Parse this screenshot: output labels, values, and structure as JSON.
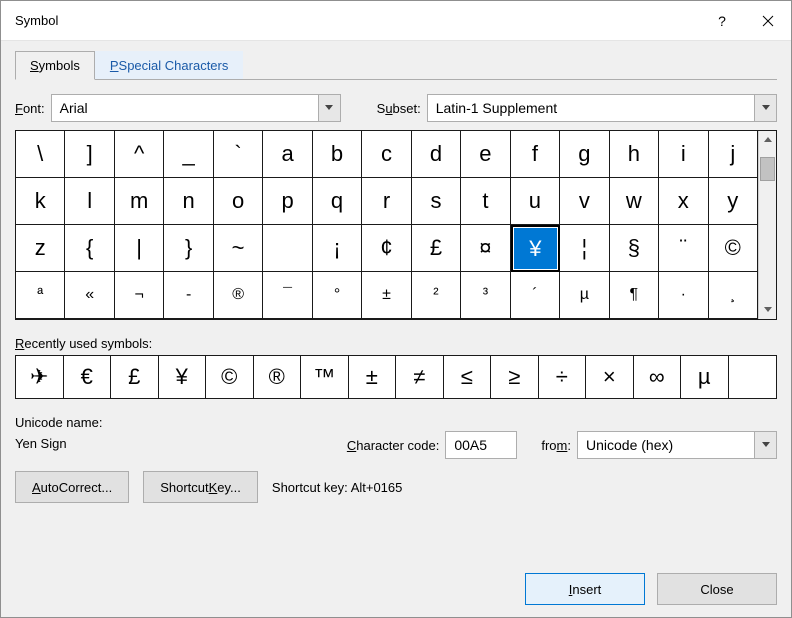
{
  "title": "Symbol",
  "tabs": {
    "symbols": "Symbols",
    "special": "Special Characters"
  },
  "font": {
    "label": "Font:",
    "value": "Arial"
  },
  "subset": {
    "label": "Subset:",
    "value": "Latin-1 Supplement"
  },
  "symbol_grid": {
    "rows": [
      [
        "\\",
        "]",
        "^",
        "_",
        "`",
        "a",
        "b",
        "c",
        "d",
        "e",
        "f",
        "g",
        "h",
        "i",
        "j"
      ],
      [
        "k",
        "l",
        "m",
        "n",
        "o",
        "p",
        "q",
        "r",
        "s",
        "t",
        "u",
        "v",
        "w",
        "x",
        "y"
      ],
      [
        "z",
        "{",
        "|",
        "}",
        "~",
        "",
        "¡",
        "¢",
        "£",
        "¤",
        "¥",
        "¦",
        "§",
        "¨",
        "©"
      ],
      [
        "ª",
        "«",
        "¬",
        "-",
        "®",
        "¯",
        "°",
        "±",
        "²",
        "³",
        "´",
        "µ",
        "¶",
        "·",
        "¸"
      ]
    ],
    "selected": {
      "row": 2,
      "col": 10
    }
  },
  "recent": {
    "label": "Recently used symbols:",
    "items": [
      "✈",
      "€",
      "£",
      "¥",
      "©",
      "®",
      "™",
      "±",
      "≠",
      "≤",
      "≥",
      "÷",
      "×",
      "∞",
      "µ",
      ""
    ]
  },
  "unicode": {
    "label": "Unicode name:",
    "name": "Yen Sign"
  },
  "char_code": {
    "label": "Character code:",
    "value": "00A5"
  },
  "from": {
    "label": "from:",
    "value": "Unicode (hex)"
  },
  "buttons": {
    "autocorrect": "AutoCorrect...",
    "shortcut_key": "Shortcut Key...",
    "shortcut_display_label": "Shortcut key:",
    "shortcut_display": "Alt+0165",
    "insert": "Insert",
    "close": "Close"
  }
}
